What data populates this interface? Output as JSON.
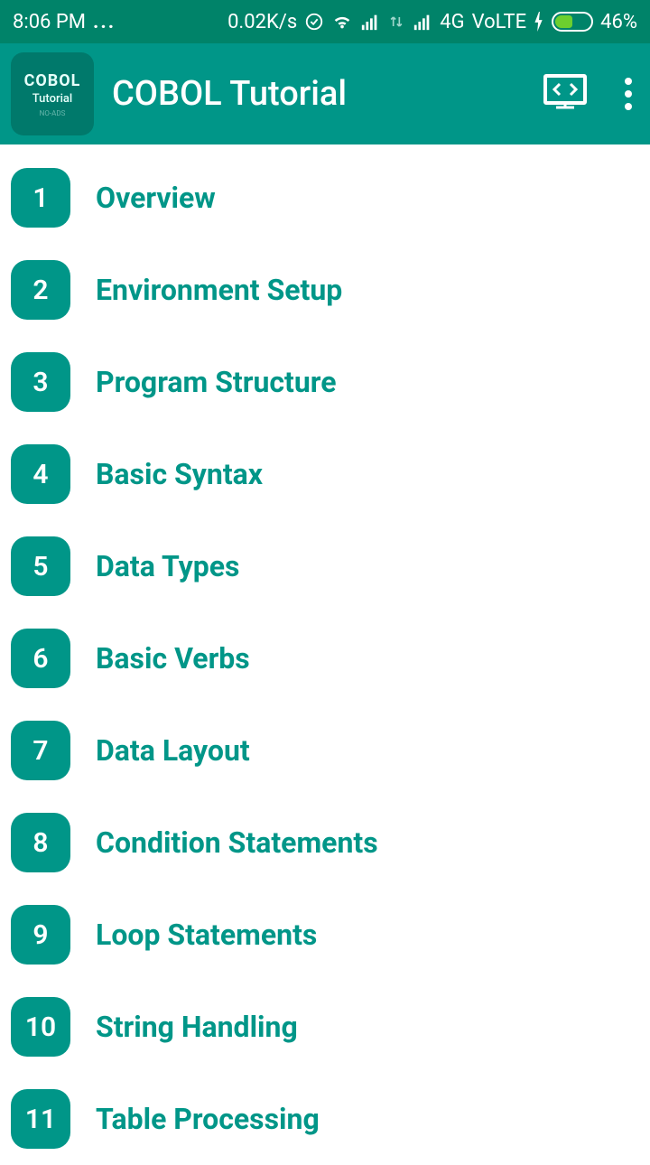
{
  "status_bar": {
    "time": "8:06 PM",
    "dots": "...",
    "speed": "0.02K/s",
    "network": "4G",
    "volte": "VoLTE",
    "battery_pct": "46%"
  },
  "app_bar": {
    "logo_line1": "COBOL",
    "logo_line2": "Tutorial",
    "logo_line3": "NO-ADS",
    "title": "COBOL Tutorial"
  },
  "items": [
    {
      "num": "1",
      "label": "Overview"
    },
    {
      "num": "2",
      "label": "Environment Setup"
    },
    {
      "num": "3",
      "label": "Program Structure"
    },
    {
      "num": "4",
      "label": "Basic Syntax"
    },
    {
      "num": "5",
      "label": "Data Types"
    },
    {
      "num": "6",
      "label": "Basic Verbs"
    },
    {
      "num": "7",
      "label": "Data Layout"
    },
    {
      "num": "8",
      "label": "Condition Statements"
    },
    {
      "num": "9",
      "label": "Loop Statements"
    },
    {
      "num": "10",
      "label": "String Handling"
    },
    {
      "num": "11",
      "label": "Table Processing"
    }
  ]
}
